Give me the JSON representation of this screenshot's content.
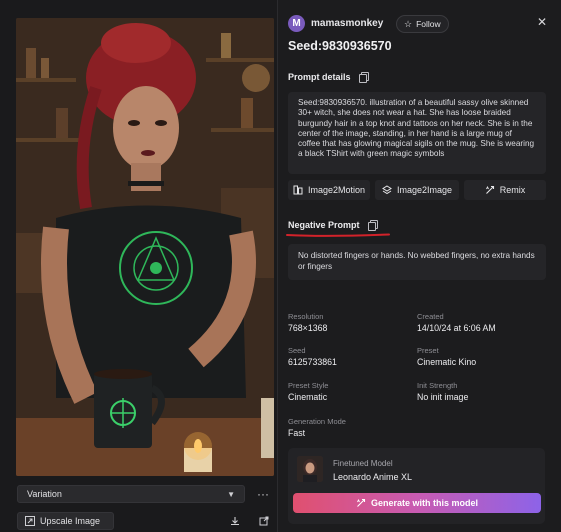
{
  "left": {
    "variation_label": "Variation",
    "upscale_label": "Upscale Image"
  },
  "header": {
    "avatar_letter": "M",
    "username": "mamasmonkey",
    "follow_label": "Follow",
    "seed_title": "Seed:9830936570"
  },
  "prompt": {
    "title": "Prompt details",
    "text": "Seed:9830936570. illustration of a beautiful sassy olive skinned 30+ witch, she does not wear a hat. She has loose braided burgundy hair in a top knot and tattoos on her neck. She is in the center of the image, standing, in her hand is a large mug of coffee that has glowing magical sigils on the mug. She is wearing a black TShirt with green magic symbols"
  },
  "actions": {
    "image2motion": "Image2Motion",
    "image2image": "Image2Image",
    "remix": "Remix"
  },
  "negative": {
    "title": "Negative Prompt",
    "text": "No distorted fingers or hands. No webbed fingers, no extra hands or fingers"
  },
  "meta": {
    "resolution_label": "Resolution",
    "resolution_value": "768×1368",
    "created_label": "Created",
    "created_value": "14/10/24 at 6:06 AM",
    "seed_label": "Seed",
    "seed_value": "6125733861",
    "preset_label": "Preset",
    "preset_value": "Cinematic Kino",
    "preset_style_label": "Preset Style",
    "preset_style_value": "Cinematic",
    "init_strength_label": "Init Strength",
    "init_strength_value": "No init image",
    "generation_mode_label": "Generation Mode",
    "generation_mode_value": "Fast"
  },
  "model": {
    "kicker": "Finetuned Model",
    "name": "Leonardo Anime XL",
    "generate_label": "Generate with this model"
  },
  "colors": {
    "accent_gradient_start": "#e0506f",
    "accent_gradient_end": "#8d63e8",
    "annotation_red": "#d2222a",
    "avatar_bg": "#7a5bbd"
  }
}
